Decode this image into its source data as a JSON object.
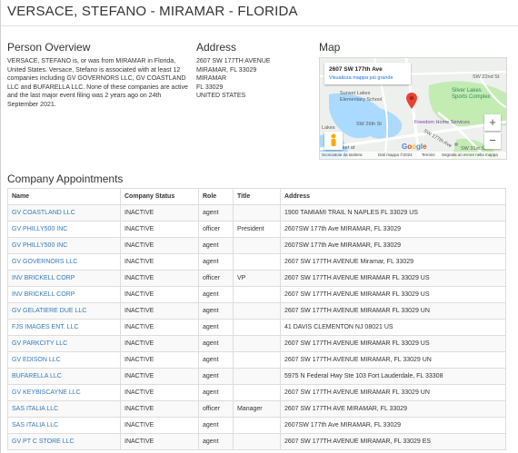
{
  "page": {
    "title": "VERSACE, STEFANO - MIRAMAR - FLORIDA"
  },
  "overview": {
    "heading": "Person Overview",
    "text": "VERSACE, STEFANO is, or was from MIRAMAR in Florida, United States. Versace, Stefano is associated with at least 12 companies including GV GOVERNORS LLC, GV COASTLAND LLC and BUFARELLA LLC. None of these companies are active and the last major event filing was 2 years ago on 24th September 2021."
  },
  "address": {
    "heading": "Address",
    "lines": [
      "2607 SW 177TH AVENUE",
      "MIRAMAR, FL 33029",
      "MIRAMAR",
      "FL 33029",
      "UNITED STATES"
    ]
  },
  "map": {
    "heading": "Map",
    "card_address": "2607 SW 177th Ave",
    "card_link": "Visualizza mappa più grande",
    "labels": {
      "poi_silver_lakes": "Silver Lakes",
      "poi_sports_complex": "Sports Complex",
      "sunset_lakes": "Sunset Lakes",
      "elementary": "Elementary School",
      "freedom_home": "Freedom Home Services",
      "lakes": "Lakes",
      "market": "arket at",
      "street_sw177": "SW 177th Ave",
      "street_sw26": "SW 26th St",
      "street_sw22": "SW 22nd St",
      "street_sw31": "SW 31st St"
    },
    "zoom_in": "+",
    "zoom_out": "−",
    "google": "Google",
    "footer": {
      "shortcuts": "Scorciatoie da tastiera",
      "data": "Dati mappa ©2024",
      "terms": "Termini",
      "report": "Segnala un errore nella mappa"
    }
  },
  "appointments": {
    "heading": "Company Appointments",
    "columns": [
      "Name",
      "Company Status",
      "Role",
      "Title",
      "Address"
    ],
    "rows": [
      [
        "GV COASTLAND LLC",
        "INACTIVE",
        "agent",
        "",
        "1900 TAMIAMI TRAIL N NAPLES FL 33029 US"
      ],
      [
        "GV PHILLY500 INC",
        "INACTIVE",
        "officer",
        "President",
        "2607SW 177th Ave MIRAMAR, FL 33029"
      ],
      [
        "GV PHILLY500 INC",
        "INACTIVE",
        "agent",
        "",
        "2607SW 177th Ave MIRAMAR, FL 33029"
      ],
      [
        "GV GOVERNORS LLC",
        "INACTIVE",
        "agent",
        "",
        "2607 SW 177TH AVENUE Miramar, FL 33029"
      ],
      [
        "INV BRICKELL CORP",
        "INACTIVE",
        "officer",
        "VP",
        "2607 SW 177TH AVENUE MIRAMAR FL 33029 US"
      ],
      [
        "INV BRICKELL CORP",
        "INACTIVE",
        "agent",
        "",
        "2607 SW 177TH AVENUE MIRAMAR FL 33029 US"
      ],
      [
        "GV GELATIERE DUE LLC",
        "INACTIVE",
        "agent",
        "",
        "2607 SW 177TH AVENUE MIRAMAR FL 33029 UN"
      ],
      [
        "FJS IMAGES ENT. LLC",
        "INACTIVE",
        "agent",
        "",
        "41 DAVIS CLEMENTON NJ 08021 US"
      ],
      [
        "GV PARKCITY LLC",
        "INACTIVE",
        "agent",
        "",
        "2607 SW 177TH AVENUE MIRAMAR FL 33029 US"
      ],
      [
        "GV EDISON LLC",
        "INACTIVE",
        "agent",
        "",
        "2607 SW 177TH AVENUE MIRAMAR, FL 33029 UN"
      ],
      [
        "BUFARELLA LLC",
        "INACTIVE",
        "agent",
        "",
        "5975 N Federal Hwy Ste 103 Fort Lauderdale, FL 33308"
      ],
      [
        "GV KEYBISCAYNE LLC",
        "INACTIVE",
        "agent",
        "",
        "2607 SW 177TH AVENUE MIRAMAR FL 33029 UN"
      ],
      [
        "SAS ITALIA LLC",
        "INACTIVE",
        "officer",
        "Manager",
        "2607 SW 177TH AVE MIRAMAR, FL 33029"
      ],
      [
        "SAS ITALIA LLC",
        "INACTIVE",
        "agent",
        "",
        "2607SW 177th Ave MIRAMAR, FL 33029"
      ],
      [
        "GV PT C STORE LLC",
        "INACTIVE",
        "agent",
        "",
        "2607 SW 177TH AVENUE MIRAMAR, FL 33029 ES"
      ]
    ]
  },
  "colors": {
    "link": "#337ab7",
    "map_water": "#aadaff",
    "map_park": "#c3ecb2",
    "marker": "#ea4335"
  }
}
